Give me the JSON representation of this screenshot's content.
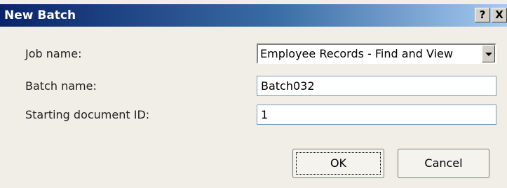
{
  "window": {
    "title": "New Batch",
    "help_glyph": "?",
    "close_glyph": "X"
  },
  "form": {
    "job_name_label": "Job name:",
    "job_name_value": "Employee Records - Find and View",
    "batch_name_label": "Batch name:",
    "batch_name_value": "Batch032",
    "start_id_label": "Starting document ID:",
    "start_id_value": "1"
  },
  "buttons": {
    "ok_label": "OK",
    "cancel_label": "Cancel"
  }
}
